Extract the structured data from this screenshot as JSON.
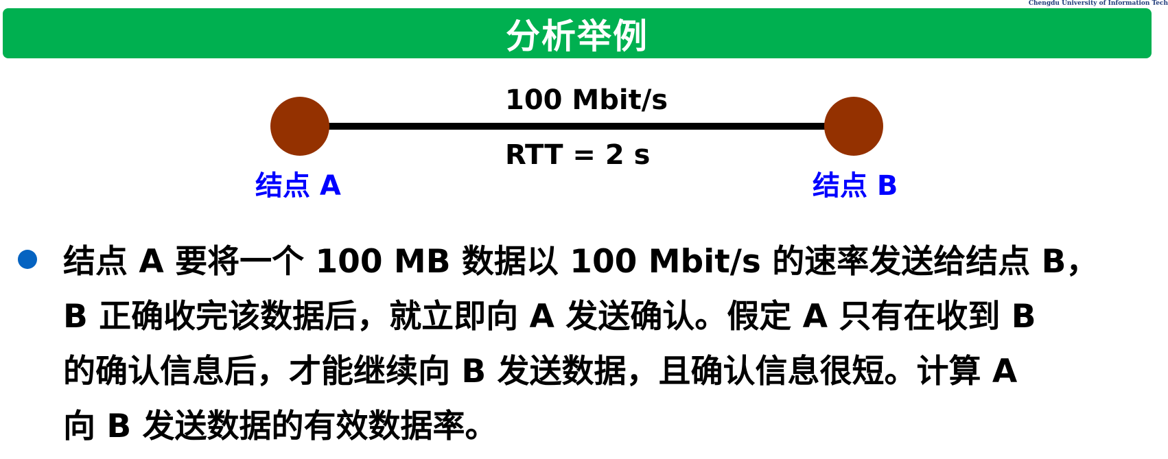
{
  "header": {
    "university": "Chengdu University of Information Tech",
    "title": "分析举例"
  },
  "diagram": {
    "link": {
      "bandwidth": "100 Mbit/s",
      "rtt": "RTT = 2 s"
    },
    "node_a": {
      "label": "结点 A",
      "color": "#943100"
    },
    "node_b": {
      "label": "结点 B",
      "color": "#943100"
    },
    "label_color": "#0000ff"
  },
  "body": {
    "lines": [
      "结点 A 要将一个 100 MB 数据以 100 Mbit/s 的速率发送给结点 B，",
      "B 正确收完该数据后，就立即向 A 发送确认。假定 A 只有在收到 B",
      "的确认信息后，才能继续向 B 发送数据，且确认信息很短。计算 A",
      "向 B 发送数据的有效数据率。"
    ]
  },
  "colors": {
    "title_bar": "#00b050",
    "bullet": "#0563c1"
  }
}
